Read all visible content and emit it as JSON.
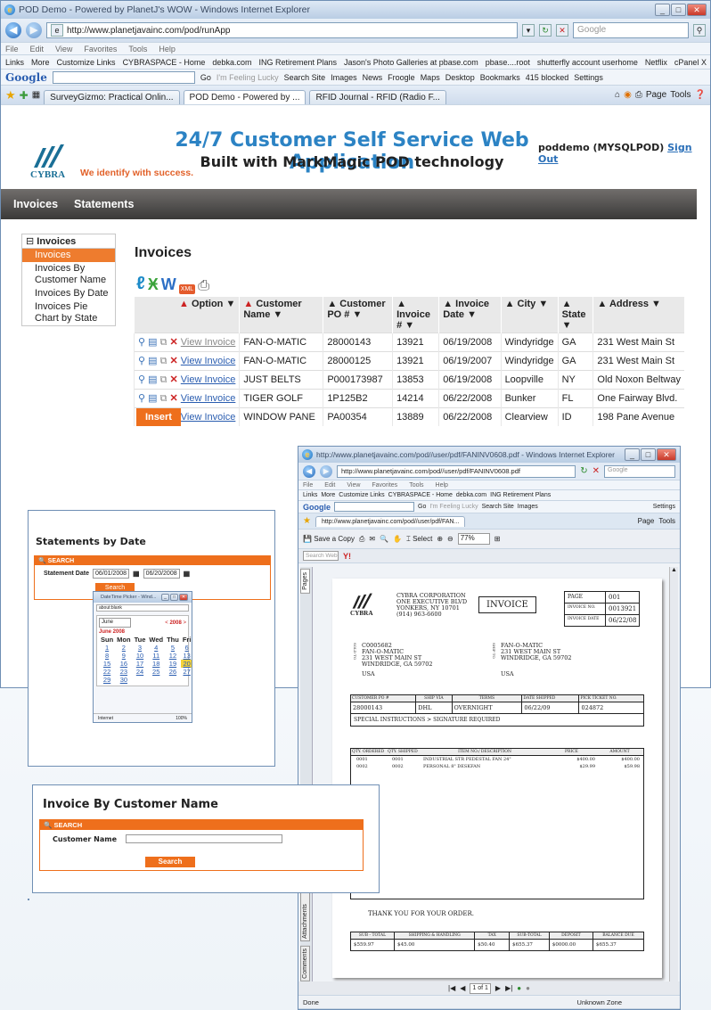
{
  "browser": {
    "title": "POD Demo - Powered by PlanetJ's WOW - Windows Internet Explorer",
    "url": "http://www.planetjavainc.com/pod/runApp",
    "search_placeholder": "Google",
    "menu": [
      "File",
      "Edit",
      "View",
      "Favorites",
      "Tools",
      "Help"
    ],
    "links": [
      "Links",
      "More",
      "Customize Links",
      "CYBRASPACE - Home",
      "debka.com",
      "ING Retirement Plans",
      "Jason's Photo Galleries at pbase.com",
      "pbase....root",
      "shutterfly account userhome",
      "Netflix",
      "cPanel X"
    ],
    "google_toolbar": [
      "Google",
      "Go",
      "I'm Feeling Lucky",
      "Search Site",
      "Images",
      "News",
      "Froogle",
      "Maps",
      "Desktop",
      "Bookmarks",
      "415 blocked",
      "Settings"
    ],
    "tabs": [
      "SurveyGizmo: Practical Onlin...",
      "POD Demo - Powered by ...",
      "RFID Journal - RFID (Radio F..."
    ],
    "cmd": [
      "Page",
      "Tools"
    ]
  },
  "app": {
    "logo": "CYBRA",
    "tagline": "We identify with success.",
    "title": "24/7 Customer Self Service Web Application",
    "subtitle": "Built with MarkMagic POD technology",
    "user": "poddemo (MYSQLPOD)",
    "signout": "Sign Out",
    "nav": [
      "Invoices",
      "Statements"
    ],
    "sidebar": {
      "header": "Invoices",
      "items": [
        "Invoices",
        "Invoices By Customer Name",
        "Invoices By Date",
        "Invoices Pie Chart by State"
      ]
    },
    "page_title": "Invoices",
    "insert": "Insert",
    "columns": [
      "Option",
      "Customer Name",
      "Customer PO #",
      "Invoice #",
      "Invoice Date",
      "City",
      "State",
      "Address"
    ],
    "rows": [
      {
        "link": "View Invoice",
        "name": "FAN-O-MATIC",
        "po": "28000143",
        "inv": "13921",
        "date": "06/19/2008",
        "city": "Windyridge",
        "state": "GA",
        "addr": "231 West Main St"
      },
      {
        "link": "View Invoice",
        "name": "FAN-O-MATIC",
        "po": "28000125",
        "inv": "13921",
        "date": "06/19/2007",
        "city": "Windyridge",
        "state": "GA",
        "addr": "231 West Main St"
      },
      {
        "link": "View Invoice",
        "name": "JUST BELTS",
        "po": "P000173987",
        "inv": "13853",
        "date": "06/19/2008",
        "city": "Loopville",
        "state": "NY",
        "addr": "Old Noxon Beltway"
      },
      {
        "link": "View Invoice",
        "name": "TIGER GOLF",
        "po": "1P125B2",
        "inv": "14214",
        "date": "06/22/2008",
        "city": "Bunker",
        "state": "FL",
        "addr": "One Fairway Blvd."
      },
      {
        "link": "View Invoice",
        "name": "WINDOW PANE",
        "po": "PA00354",
        "inv": "13889",
        "date": "06/22/2008",
        "city": "Clearview",
        "state": "ID",
        "addr": "198 Pane Avenue"
      }
    ]
  },
  "pdf": {
    "title": "http://www.planetjavainc.com/pod//user/pdf/FANINV0608.pdf - Windows Internet Explorer",
    "url": "http://www.planetjavainc.com/pod//user/pdf/FANINV0608.pdf",
    "tab": "http://www.planetjavainc.com/pod//user/pdf/FAN...",
    "save": "Save a Copy",
    "select": "Select",
    "zoom": "77%",
    "searchweb": "Search Web",
    "pages_tab": "Pages",
    "attach_tab": "Attachments",
    "comments_tab": "Comments",
    "company": [
      "CYBRA CORPORATION",
      "ONE EXECUTIVE BLVD",
      "YONKERS, NY 10701",
      "(914) 963-6600"
    ],
    "doc": "INVOICE",
    "page_lbl": "PAGE",
    "page_no": "001",
    "invno_lbl": "INVOICE NO.",
    "invno": "0013921",
    "invdate_lbl": "INVOICE DATE",
    "invdate": "06/22/08",
    "sold": [
      "C0005682",
      "FAN-O-MATIC",
      "231 WEST MAIN ST",
      "WINDRIDGE, GA 59702",
      "USA"
    ],
    "soldto_lbl": "SOLD TO",
    "ship": [
      "FAN-O-MATIC",
      "231 WEST MAIN ST",
      "WINDRIDGE, GA 59702",
      "USA"
    ],
    "shipto_lbl": "SHIP TO",
    "hdr": [
      "CUSTOMER PO #",
      "SHIP VIA",
      "TERMS",
      "DATE SHIPPED",
      "PICK TICKET NO."
    ],
    "vals": [
      "28000143",
      "DHL",
      "OVERNIGHT",
      "06/22/09",
      "024872"
    ],
    "special": "SPECIAL INSTRUCTIONS > SIGNATURE REQUIRED",
    "lhdr": [
      "QTY. ORDERED",
      "QTY. SHIPPED",
      "ITEM NO./ DESCRIPTION",
      "PRICE",
      "AMOUNT"
    ],
    "lines": [
      {
        "o": "0001",
        "s": "0001",
        "d": "INDUSTRIAL STR PEDESTAL FAN 24\"",
        "p": "$400.00",
        "a": "$400.00"
      },
      {
        "o": "0002",
        "s": "0002",
        "d": "PERSONAL 8\" DESKFAN",
        "p": "$29.99",
        "a": "$59.98"
      }
    ],
    "thanks": "THANK YOU FOR YOUR ORDER.",
    "thdr": [
      "SUB - TOTAL",
      "SHIPPING & HANDLING",
      "TAX",
      "SUB-TOTAL",
      "DEPOSIT",
      "BALANCE DUE"
    ],
    "tvals": [
      "$559.97",
      "$45.00",
      "$50.40",
      "$655.37",
      "$0000.00",
      "$655.37"
    ],
    "pager": "1 of 1",
    "done": "Done",
    "zone": "Unknown Zone"
  },
  "stmt": {
    "title": "Statements by Date",
    "search": "SEARCH",
    "label": "Statement Date",
    "from": "06/01/2008",
    "to": "06/20/2008",
    "btn": "Search"
  },
  "picker": {
    "title": "DateTime Picker - Wind...",
    "addr": "about:blank",
    "month": "June",
    "year": "2008",
    "heading": "June 2008",
    "days": [
      "Sun",
      "Mon",
      "Tue",
      "Wed",
      "Thu",
      "Fri",
      "Sat"
    ],
    "weeks": [
      [
        "1",
        "2",
        "3",
        "4",
        "5",
        "6",
        "7"
      ],
      [
        "8",
        "9",
        "10",
        "11",
        "12",
        "13",
        "14"
      ],
      [
        "15",
        "16",
        "17",
        "18",
        "19",
        "20",
        "21"
      ],
      [
        "22",
        "23",
        "24",
        "25",
        "26",
        "27",
        "28"
      ],
      [
        "29",
        "30",
        "",
        "",
        "",
        "",
        ""
      ]
    ],
    "status": "Internet",
    "zoom": "100%"
  },
  "cust": {
    "title": "Invoice By Customer Name",
    "search": "SEARCH",
    "label": "Customer Name",
    "btn": "Search"
  }
}
